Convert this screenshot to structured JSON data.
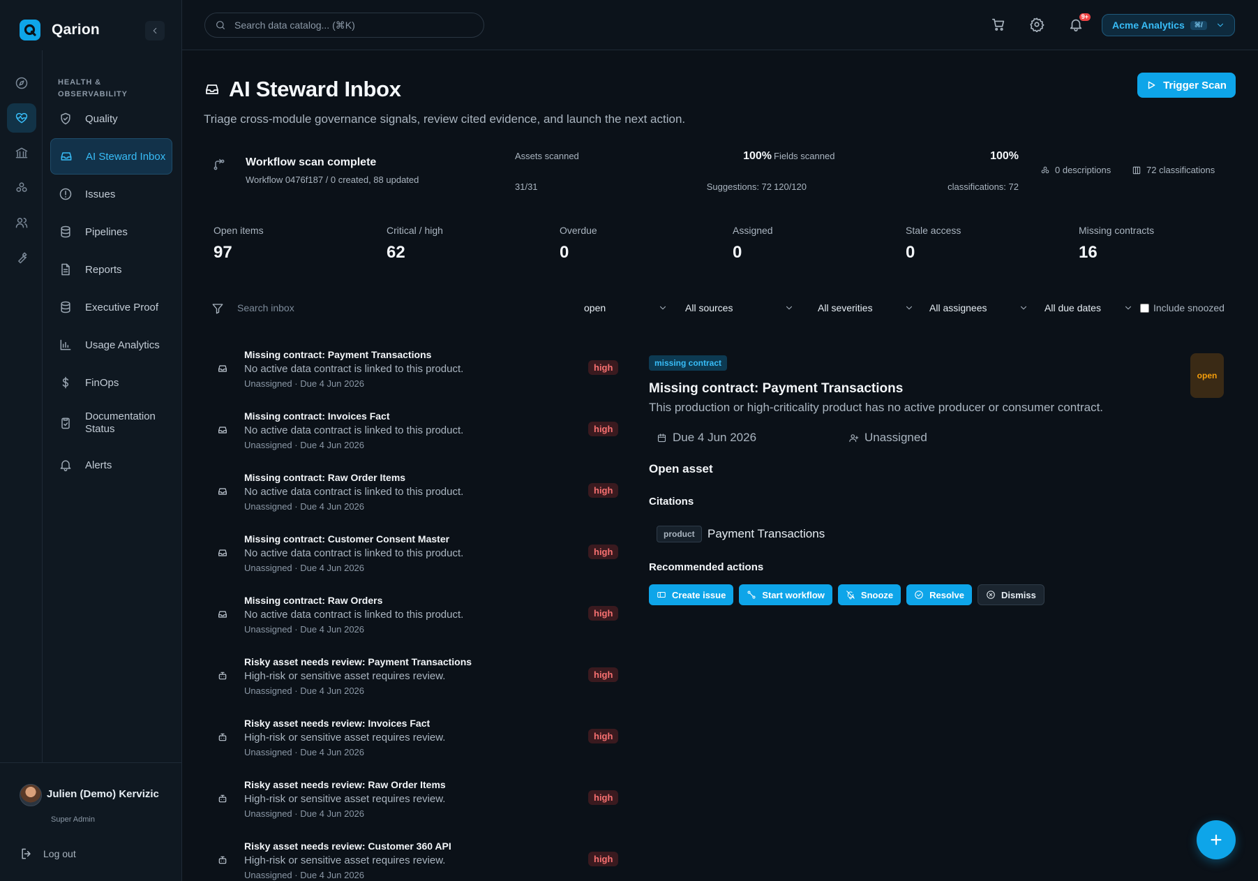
{
  "app": {
    "name": "Qarion"
  },
  "sidebar": {
    "section_label": "HEALTH & OBSERVABILITY",
    "items": [
      {
        "label": "Quality",
        "icon": "shield-check-icon"
      },
      {
        "label": "AI Steward Inbox",
        "icon": "inbox-icon",
        "active": true
      },
      {
        "label": "Issues",
        "icon": "alert-circle-icon"
      },
      {
        "label": "Pipelines",
        "icon": "database-icon"
      },
      {
        "label": "Reports",
        "icon": "file-text-icon"
      },
      {
        "label": "Executive Proof",
        "icon": "database-icon"
      },
      {
        "label": "Usage Analytics",
        "icon": "bar-chart-icon"
      },
      {
        "label": "FinOps",
        "icon": "dollar-icon"
      },
      {
        "label": "Documentation Status",
        "icon": "clipboard-check-icon"
      },
      {
        "label": "Alerts",
        "icon": "bell-icon"
      }
    ],
    "rail": [
      "compass-icon",
      "heart-pulse-icon",
      "bank-icon",
      "grid-nodes-icon",
      "users-icon",
      "wrench-icon"
    ],
    "user": {
      "name": "Julien (Demo) Kervizic",
      "role": "Super Admin"
    },
    "logout_label": "Log out"
  },
  "topbar": {
    "search_placeholder": "Search data catalog... (⌘K)",
    "notification_badge": "9+",
    "org_name": "Acme Analytics",
    "org_shortcut": "⌘/"
  },
  "page": {
    "title": "AI Steward Inbox",
    "subtitle": "Triage cross-module governance signals, review cited evidence, and launch the next action.",
    "trigger_label": "Trigger Scan"
  },
  "scan": {
    "title": "Workflow scan complete",
    "subtitle": "Workflow 0476f187 / 0 created, 88 updated",
    "assets_label": "Assets scanned",
    "assets_pct": "100%",
    "assets_count": "31/31",
    "assets_suggestions": "Suggestions: 72",
    "fields_label": "Fields scanned",
    "fields_pct": "100%",
    "fields_count": "120/120",
    "fields_classifications": "classifications: 72",
    "descriptions": "0 descriptions",
    "classifications": "72 classifications"
  },
  "stats": [
    {
      "label": "Open items",
      "value": "97"
    },
    {
      "label": "Critical / high",
      "value": "62"
    },
    {
      "label": "Overdue",
      "value": "0"
    },
    {
      "label": "Assigned",
      "value": "0"
    },
    {
      "label": "Stale access",
      "value": "0"
    },
    {
      "label": "Missing contracts",
      "value": "16"
    }
  ],
  "filters": {
    "search_placeholder": "Search inbox",
    "status": "open",
    "sources": "All sources",
    "severities": "All severities",
    "assignees": "All assignees",
    "due_dates": "All due dates",
    "include_snoozed": "Include snoozed"
  },
  "inbox": [
    {
      "title": "Missing contract: Payment Transactions",
      "desc": "No active data contract is linked to this product.",
      "meta": "Unassigned · Due 4 Jun 2026",
      "severity": "high",
      "icon": "inbox-icon"
    },
    {
      "title": "Missing contract: Invoices Fact",
      "desc": "No active data contract is linked to this product.",
      "meta": "Unassigned · Due 4 Jun 2026",
      "severity": "high",
      "icon": "inbox-icon"
    },
    {
      "title": "Missing contract: Raw Order Items",
      "desc": "No active data contract is linked to this product.",
      "meta": "Unassigned · Due 4 Jun 2026",
      "severity": "high",
      "icon": "inbox-icon"
    },
    {
      "title": "Missing contract: Customer Consent Master",
      "desc": "No active data contract is linked to this product.",
      "meta": "Unassigned · Due 4 Jun 2026",
      "severity": "high",
      "icon": "inbox-icon"
    },
    {
      "title": "Missing contract: Raw Orders",
      "desc": "No active data contract is linked to this product.",
      "meta": "Unassigned · Due 4 Jun 2026",
      "severity": "high",
      "icon": "inbox-icon"
    },
    {
      "title": "Risky asset needs review: Payment Transactions",
      "desc": "High-risk or sensitive asset requires review.",
      "meta": "Unassigned · Due 4 Jun 2026",
      "severity": "high",
      "icon": "robot-icon"
    },
    {
      "title": "Risky asset needs review: Invoices Fact",
      "desc": "High-risk or sensitive asset requires review.",
      "meta": "Unassigned · Due 4 Jun 2026",
      "severity": "high",
      "icon": "robot-icon"
    },
    {
      "title": "Risky asset needs review: Raw Order Items",
      "desc": "High-risk or sensitive asset requires review.",
      "meta": "Unassigned · Due 4 Jun 2026",
      "severity": "high",
      "icon": "robot-icon"
    },
    {
      "title": "Risky asset needs review: Customer 360 API",
      "desc": "High-risk or sensitive asset requires review.",
      "meta": "Unassigned · Due 4 Jun 2026",
      "severity": "high",
      "icon": "robot-icon"
    }
  ],
  "detail": {
    "tag": "missing contract",
    "status": "open",
    "title": "Missing contract: Payment Transactions",
    "description": "This production or high-criticality product has no active producer or consumer contract.",
    "due": "Due 4 Jun 2026",
    "assignee": "Unassigned",
    "open_asset": "Open asset",
    "citations_heading": "Citations",
    "citation_type": "product",
    "citation_name": "Payment Transactions",
    "actions_heading": "Recommended actions",
    "actions": {
      "create_issue": "Create issue",
      "start_workflow": "Start workflow",
      "snooze": "Snooze",
      "resolve": "Resolve",
      "dismiss": "Dismiss"
    }
  },
  "colors": {
    "accent": "#0ea5e9",
    "background": "#0b1118",
    "severity_high": "#f87171",
    "status_open": "#f59e0b"
  }
}
